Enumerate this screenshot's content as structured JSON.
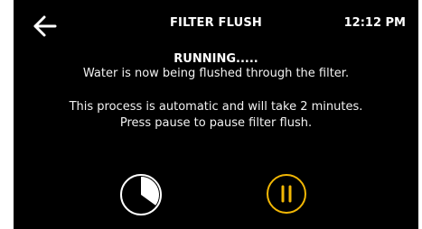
{
  "header": {
    "back_icon": "arrow-left-icon",
    "title": "FILTER FLUSH",
    "time": "12:12 PM"
  },
  "main": {
    "status": "RUNNING.....",
    "message_1": "Water is now being flushed through the filter.",
    "message_2": "This process is automatic and will take 2 minutes.",
    "message_3": "Press pause to pause filter flush."
  },
  "controls": {
    "timer_icon": "progress-timer-icon",
    "timer_progress": 0.35,
    "pause_icon": "pause-icon",
    "accent_color": "#f2b705"
  },
  "colors": {
    "background": "#000000",
    "text": "#ffffff",
    "accent": "#f2b705"
  }
}
